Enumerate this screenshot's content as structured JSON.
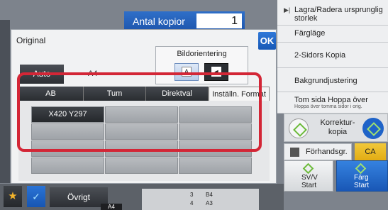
{
  "copies": {
    "label": "Antal kopior",
    "value": "1"
  },
  "dialog": {
    "title": "Original",
    "ok_label": "OK",
    "orientation": {
      "label": "Bildorientering",
      "option_a": "A",
      "option_b": "A"
    },
    "auto_label": "Auto",
    "size_value": "A4",
    "tabs": [
      "AB",
      "Tum",
      "Direktval",
      "Inställn. Format"
    ],
    "grid_cells": [
      "X420 Y297",
      "",
      "",
      "",
      "",
      "",
      "",
      "",
      "",
      "",
      "",
      ""
    ]
  },
  "right_menu": {
    "items": [
      {
        "label": "Lagra/Radera ursprunglig storlek"
      },
      {
        "label": "Färgläge"
      },
      {
        "label": "2-Sidors Kopia"
      },
      {
        "label": "Bakgrundjustering"
      },
      {
        "label": "Tom sida Hoppa över",
        "sub": "Hoppa över tomma sidor i orig."
      }
    ]
  },
  "korrektur": {
    "label": "Korrektur-kopia"
  },
  "preview_label": "Förhandsgr.",
  "ca_label": "CA",
  "start_bw": {
    "line1": "SV/V",
    "line2": "Start"
  },
  "start_color": {
    "line1": "Färg",
    "line2": "Start"
  },
  "bottom": {
    "ovrigt_label": "Övrigt",
    "tray_rows": [
      [
        "3",
        "B4"
      ],
      [
        "4",
        "A3"
      ]
    ],
    "tray_selected": "A4"
  },
  "colors": {
    "accent_blue": "#1e56ad",
    "highlight_red": "#d32636",
    "ca_yellow": "#e2ac14"
  },
  "icons": [
    "ok-icon",
    "star-icon",
    "check-icon",
    "preview-icon",
    "diamond-icon"
  ]
}
